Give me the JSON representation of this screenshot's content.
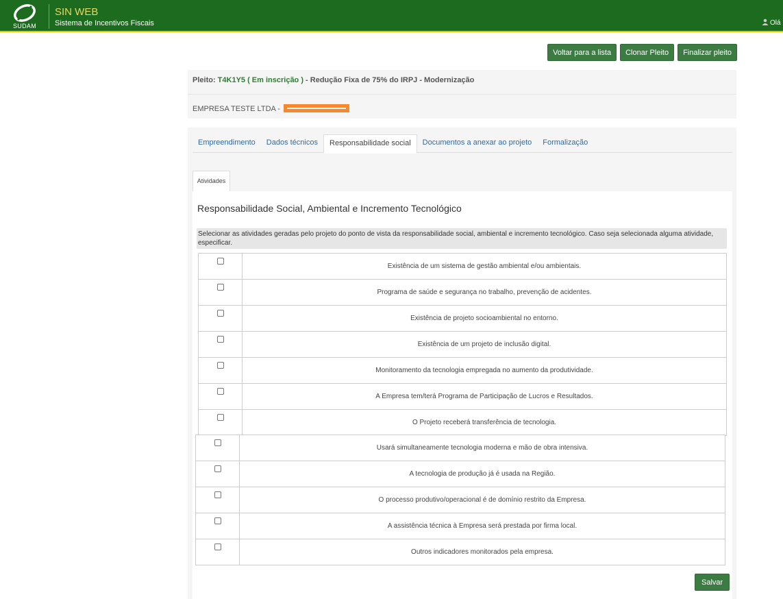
{
  "header": {
    "logo_text": "SUDAM",
    "app_name": "SIN WEB",
    "app_subtitle": "Sistema de Incentivos Fiscais",
    "user_greeting": "Olá I"
  },
  "actions": {
    "back_label": "Voltar para a lista",
    "clone_label": "Clonar Pleito",
    "finish_label": "Finalizar pleito"
  },
  "pleito": {
    "prefix": "Pleito: ",
    "code_status": "T4K1Y5 ( Em inscrição )",
    "suffix": " - Redução Fixa de 75% do IRPJ - Modernização",
    "empresa": "EMPRESA TESTE LTDA - "
  },
  "tabs": [
    {
      "label": "Empreendimento"
    },
    {
      "label": "Dados técnicos"
    },
    {
      "label": "Responsabilidade social"
    },
    {
      "label": "Documentos a anexar ao projeto"
    },
    {
      "label": "Formalização"
    }
  ],
  "subtab": {
    "label": "Atividades"
  },
  "section": {
    "title": "Responsabilidade Social, Ambiental e Incremento Tecnológico",
    "instruction": "Selecionar as atividades geradas pelo projeto do ponto de vista da responsabilidade social, ambiental e incremento tecnológico. Caso seja selecionada alguma atividade, especificar."
  },
  "activities_top": [
    {
      "label": "Existência de um sistema de gestão ambiental e/ou ambientais."
    },
    {
      "label": "Programa de saúde e segurança no trabalho, prevenção de acidentes."
    },
    {
      "label": "Existência de projeto socioambiental no entorno."
    },
    {
      "label": "Existência de um projeto de inclusão digital."
    },
    {
      "label": "Monitoramento da tecnologia empregada no aumento da produtividade."
    },
    {
      "label": "A Empresa tem/terá Programa de Participação de Lucros e Resultados."
    },
    {
      "label": "O Projeto receberá transferência de tecnologia."
    }
  ],
  "activities_bottom": [
    {
      "label": "Usará simultaneamente tecnologia moderna e mão de obra intensiva."
    },
    {
      "label": "A tecnologia de produção já é usada na Região."
    },
    {
      "label": "O processo produtivo/operacional é de domínio restrito da Empresa."
    },
    {
      "label": "A assistência técnica à Empresa será prestada por firma local."
    },
    {
      "label": "Outros indicadores monitorados pela empresa."
    }
  ],
  "save_label": "Salvar",
  "colors": {
    "header_green": "#1c6b1e",
    "button_green": "#3c7c43",
    "accent_yellow": "#e6c200",
    "redaction": "#f7882f"
  }
}
